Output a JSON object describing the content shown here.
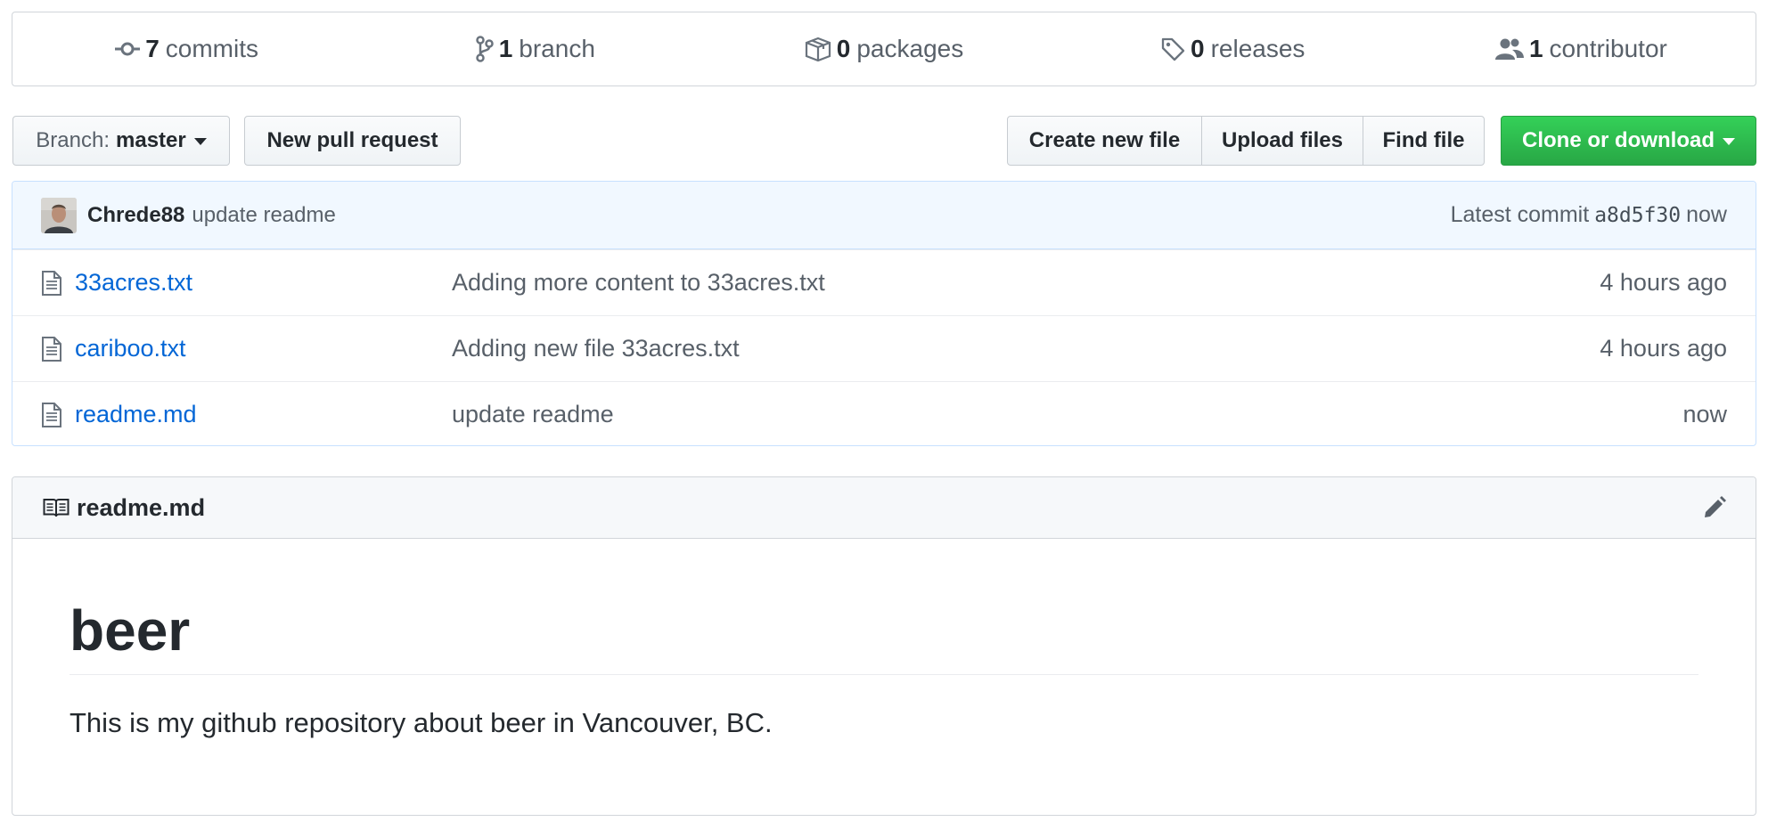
{
  "stats": {
    "commits": {
      "num": "7",
      "label": "commits",
      "icon": "commit-icon"
    },
    "branches": {
      "num": "1",
      "label": "branch",
      "icon": "branch-icon"
    },
    "packages": {
      "num": "0",
      "label": "packages",
      "icon": "package-icon"
    },
    "releases": {
      "num": "0",
      "label": "releases",
      "icon": "tag-icon"
    },
    "contributors": {
      "num": "1",
      "label": "contributor",
      "icon": "people-icon"
    }
  },
  "toolbar": {
    "branch_prefix": "Branch:",
    "branch_name": "master",
    "new_pull_request": "New pull request",
    "create_new_file": "Create new file",
    "upload_files": "Upload files",
    "find_file": "Find file",
    "clone_or_download": "Clone or download"
  },
  "latest_commit": {
    "author": "Chrede88",
    "message": "update readme",
    "prefix": "Latest commit",
    "sha": "a8d5f30",
    "time": "now"
  },
  "files": [
    {
      "name": "33acres.txt",
      "message": "Adding more content to 33acres.txt",
      "age": "4 hours ago"
    },
    {
      "name": "cariboo.txt",
      "message": "Adding new file 33acres.txt",
      "age": "4 hours ago"
    },
    {
      "name": "readme.md",
      "message": "update readme",
      "age": "now"
    }
  ],
  "readme": {
    "filename": "readme.md",
    "heading": "beer",
    "body": "This is my github repository about beer in Vancouver, BC."
  },
  "colors": {
    "link": "#0366d6",
    "clone_button": "#28a745",
    "commit_tease_bg": "#f1f8ff"
  }
}
